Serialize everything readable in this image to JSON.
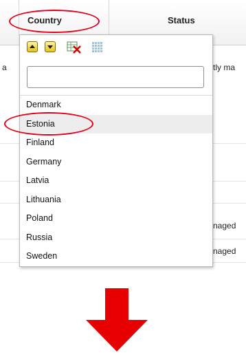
{
  "table": {
    "col_country": "Country",
    "col_status": "Status",
    "row_text": {
      "left_a": "a",
      "status_1": "tly ma",
      "status_2": "naged",
      "status_3": "naged"
    }
  },
  "filter_popup": {
    "toolbar": {
      "sort_asc_icon": "sort-ascending-icon",
      "sort_desc_icon": "sort-descending-icon",
      "clear_icon": "clear-filter-icon",
      "grid_icon": "select-all-icon"
    },
    "search": {
      "value": "",
      "placeholder": ""
    },
    "options": [
      {
        "label": "Denmark",
        "selected": false
      },
      {
        "label": "Estonia",
        "selected": true
      },
      {
        "label": "Finland",
        "selected": false
      },
      {
        "label": "Germany",
        "selected": false
      },
      {
        "label": "Latvia",
        "selected": false
      },
      {
        "label": "Lithuania",
        "selected": false
      },
      {
        "label": "Poland",
        "selected": false
      },
      {
        "label": "Russia",
        "selected": false
      },
      {
        "label": "Sweden",
        "selected": false
      }
    ]
  },
  "colors": {
    "highlight": "#e2001a",
    "arrow": "#e60000",
    "selected_row": "#ededed"
  }
}
